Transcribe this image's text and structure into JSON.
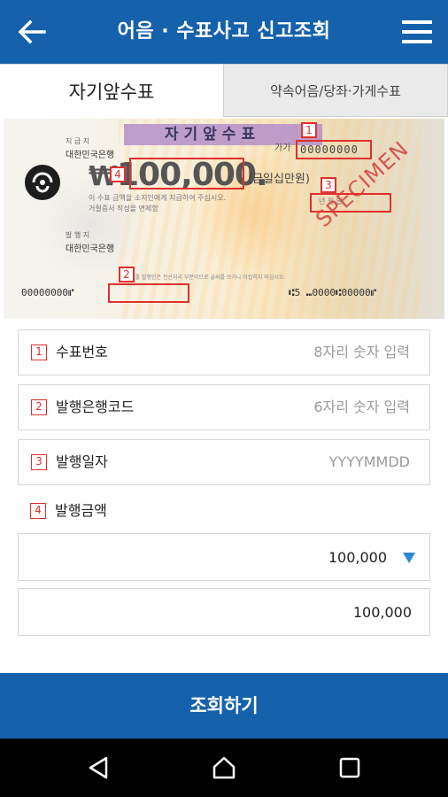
{
  "appbar": {
    "title": "어음 · 수표사고 신고조회",
    "back_icon": "arrow-left-icon",
    "menu_icon": "hamburger-menu-icon",
    "color": "#1561ab"
  },
  "tabs": [
    {
      "label": "자기앞수표",
      "active": true
    },
    {
      "label": "약속어음/당좌·가게수표",
      "active": false
    }
  ],
  "check_image": {
    "header": "자기앞수표",
    "serial_prefix": "가가",
    "serial": "00000000",
    "bank_top_small": "지 급 지",
    "bank_top": "대한민국은행",
    "amount": "100,000.",
    "currency_symbol": "₩",
    "amount_korean": "(금일십만원)",
    "fine_print_1": "이 수표 금액을 소지인에게 지급하여 주십시오.",
    "fine_print_2": "거절증서 작성을 면제함",
    "bank_bottom_small": "발 행 지",
    "bank_bottom": "대한민국은행",
    "date_labels": "년    월    일",
    "specimen": "SPECIMEN",
    "micr_left": "00000000⑈",
    "micr_right": "⑆5  ⑉0000⑆00000⑈",
    "tiny_text": "이 수표를 발행인은 전산처리 부분이므로 글씨를 쓰거나 더럽히지 마십시오.",
    "markers": [
      "1",
      "2",
      "3",
      "4"
    ]
  },
  "form": {
    "fields": [
      {
        "num": "1",
        "label": "수표번호",
        "placeholder": "8자리 숫자 입력"
      },
      {
        "num": "2",
        "label": "발행은행코드",
        "placeholder": "6자리 숫자 입력"
      },
      {
        "num": "3",
        "label": "발행일자",
        "placeholder": "YYYYMMDD"
      }
    ],
    "amount_label": {
      "num": "4",
      "label": "발행금액"
    },
    "amount_select": {
      "value": "100,000",
      "caret_icon": "caret-down-icon"
    },
    "amount_input": {
      "value": "100,000"
    }
  },
  "submit": {
    "label": "조회하기"
  },
  "navbar": {
    "back_icon": "nav-back-icon",
    "home_icon": "nav-home-icon",
    "recents_icon": "nav-recents-icon"
  },
  "colors": {
    "primary": "#1561ab",
    "marker_red": "#e0302e",
    "caret_blue": "#2a8ad4"
  }
}
